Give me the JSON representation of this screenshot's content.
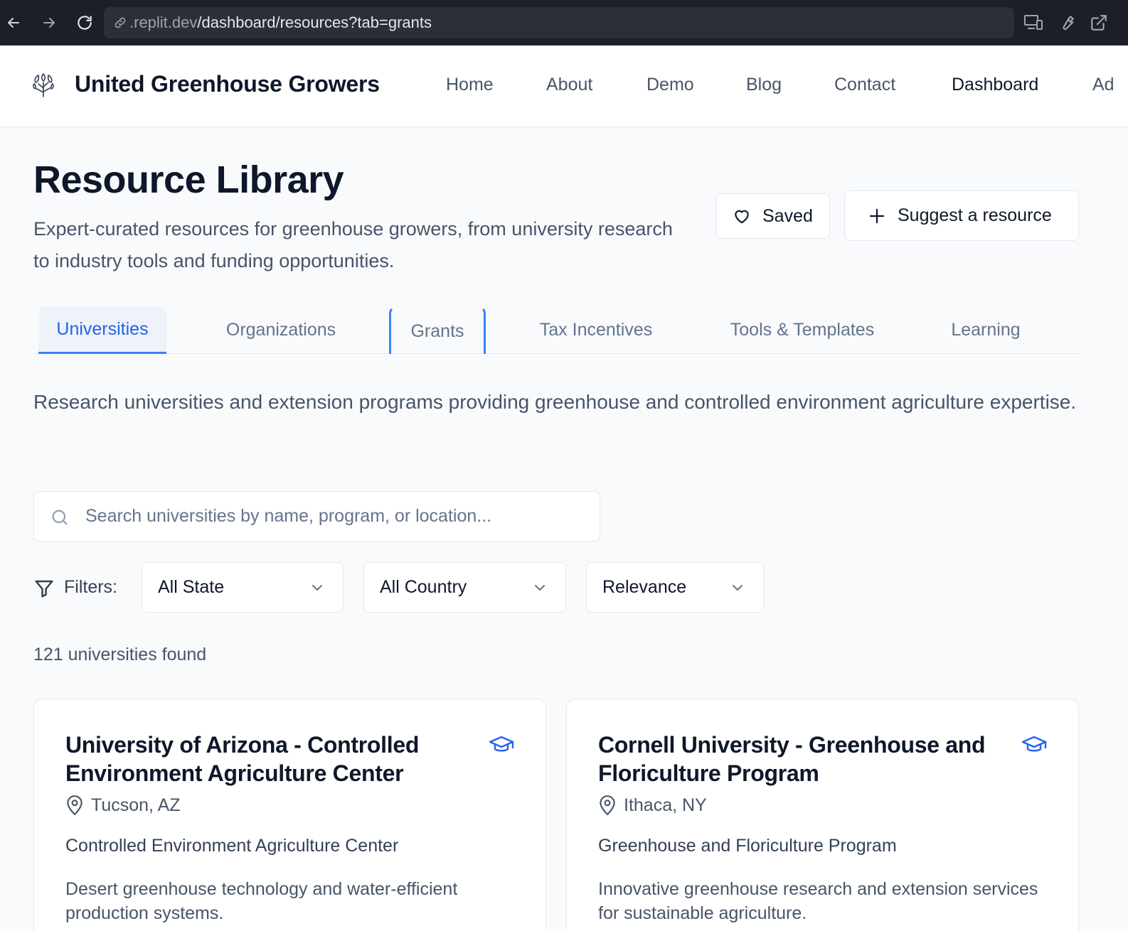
{
  "browser": {
    "url_host": ".replit.dev",
    "url_path": "/dashboard/resources?tab=grants"
  },
  "header": {
    "brand": "United Greenhouse Growers",
    "nav": [
      "Home",
      "About",
      "Demo",
      "Blog",
      "Contact",
      "Dashboard",
      "Ad"
    ],
    "active_nav": "Dashboard"
  },
  "page": {
    "title": "Resource Library",
    "subtitle": "Expert-curated resources for greenhouse growers, from university research to industry tools and funding opportunities.",
    "saved_label": "Saved",
    "suggest_label": "Suggest a resource"
  },
  "tabs": [
    {
      "label": "Universities",
      "active": true
    },
    {
      "label": "Organizations"
    },
    {
      "label": "Grants",
      "focused": true
    },
    {
      "label": "Tax Incentives"
    },
    {
      "label": "Tools & Templates"
    },
    {
      "label": "Learning"
    }
  ],
  "tab_description": "Research universities and extension programs providing greenhouse and controlled environment agriculture expertise.",
  "search": {
    "placeholder": "Search universities by name, program, or location..."
  },
  "filters": {
    "label": "Filters:",
    "state": "All State",
    "country": "All Country",
    "sort": "Relevance"
  },
  "results_count": "121 universities found",
  "cards": [
    {
      "title": "University of Arizona - Controlled Environment Agriculture Center",
      "location": "Tucson, AZ",
      "program": "Controlled Environment Agriculture Center",
      "description": "Desert greenhouse technology and water-efficient production systems."
    },
    {
      "title": "Cornell University - Greenhouse and Floriculture Program",
      "location": "Ithaca, NY",
      "program": "Greenhouse and Floriculture Program",
      "description": "Innovative greenhouse research and extension services for sustainable agriculture."
    }
  ],
  "colors": {
    "accent": "#2563eb",
    "chrome_bg": "#1c1f26",
    "page_bg": "#f8fafc"
  }
}
